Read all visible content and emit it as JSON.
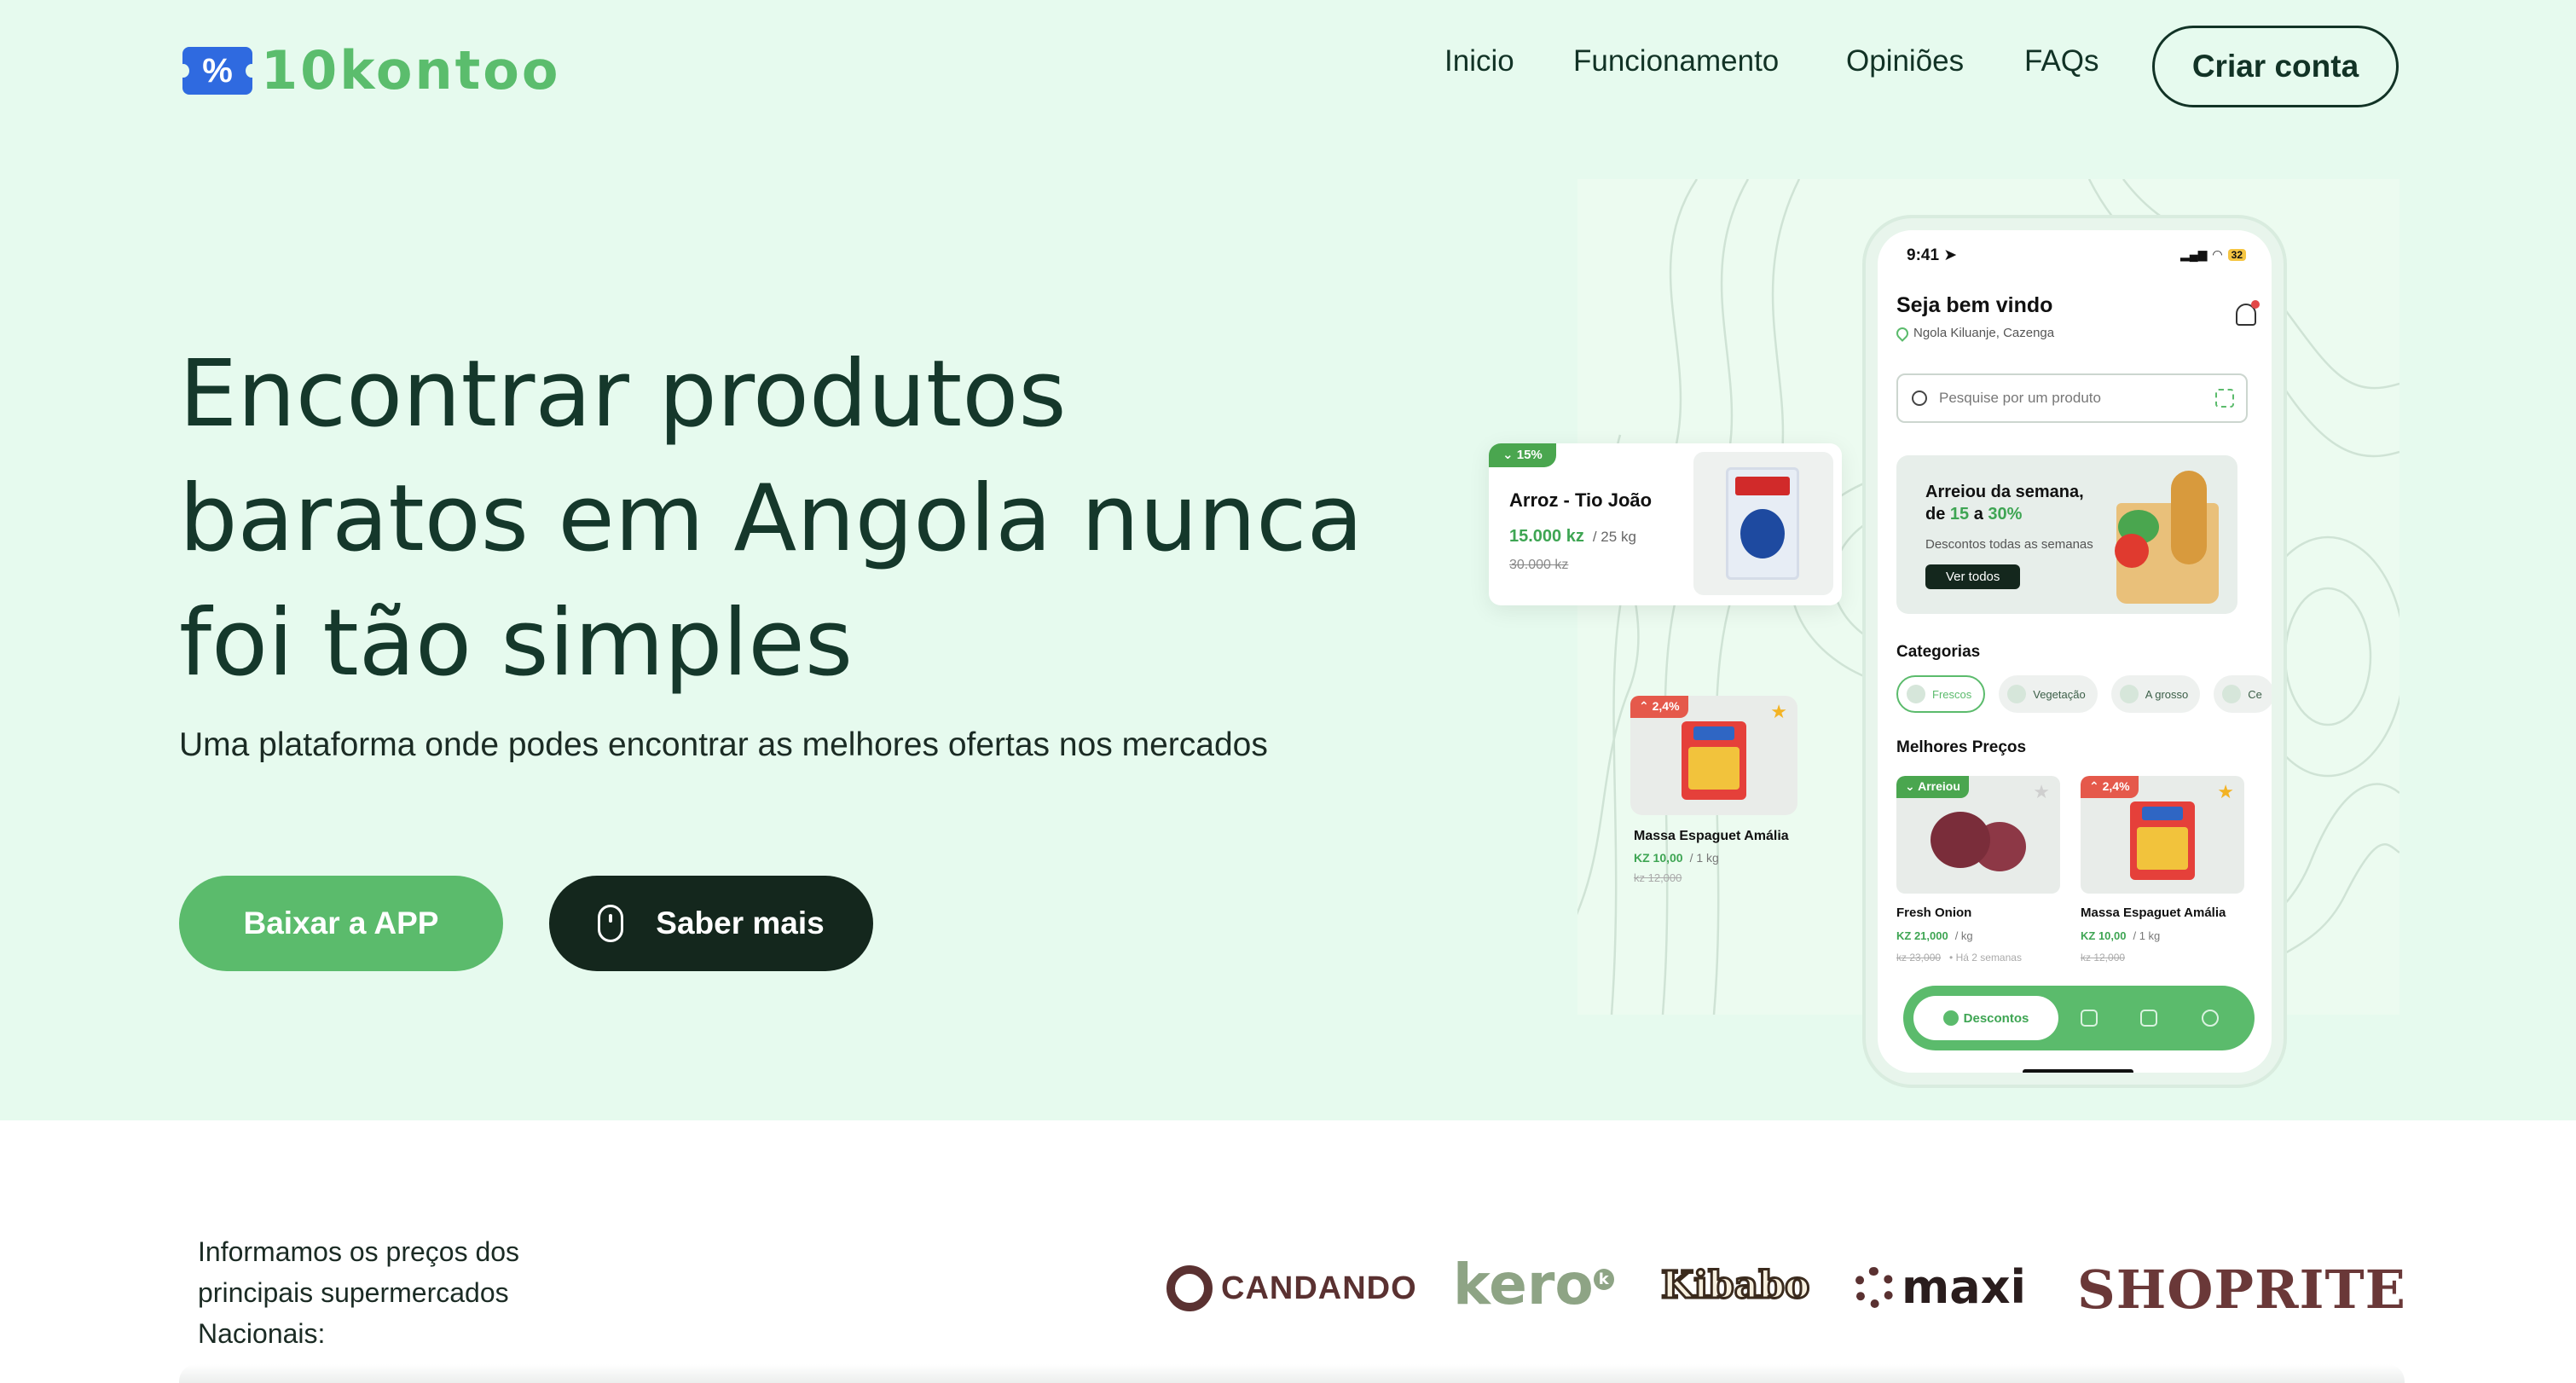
{
  "header": {
    "logo_text": "10kontoo",
    "logo_badge": "%",
    "nav": [
      "Inicio",
      "Funcionamento",
      "Opiniões",
      "FAQs"
    ],
    "cta": "Criar conta"
  },
  "hero": {
    "headline": "Encontrar produtos baratos em Angola nunca foi tão simples",
    "subline": "Uma plataforma onde podes encontrar as melhores ofertas nos mercados",
    "btn_download": "Baixar a APP",
    "btn_more": "Saber mais"
  },
  "floating_card_1": {
    "badge": "⌄ 15%",
    "name": "Arroz - Tio João",
    "price": "15.000 kz",
    "unit": "/ 25 kg",
    "old_price": "30.000 kz"
  },
  "floating_card_2": {
    "badge": "⌃ 2,4%",
    "name": "Massa Espaguet Amália",
    "price": "KZ 10,00",
    "unit": "/ 1 kg",
    "old_price": "kz 12,000"
  },
  "phone": {
    "time": "9:41",
    "battery": "32",
    "welcome": "Seja bem vindo",
    "location": "Ngola Kiluanje, Cazenga",
    "search_placeholder": "Pesquise por um produto",
    "banner_line1": "Arreiou da semana,",
    "banner_de": "de",
    "banner_from": "15",
    "banner_a": "a",
    "banner_to": "30%",
    "banner_sub": "Descontos todas as semanas",
    "banner_btn": "Ver todos",
    "categories_title": "Categorias",
    "categories": [
      "Frescos",
      "Vegetação",
      "A grosso",
      "Ce"
    ],
    "best_title": "Melhores Preços",
    "products": [
      {
        "badge": "⌄ Arreiou",
        "name": "Fresh Onion",
        "price": "KZ 21,000",
        "unit": "/ kg",
        "old_price": "kz 23,000",
        "note": "•  Há 2 semanas"
      },
      {
        "badge": "⌃ 2,4%",
        "name": "Massa Espaguet Amália",
        "price": "KZ 10,00",
        "unit": "/ 1 kg",
        "old_price": "kz 12,000",
        "note": ""
      }
    ],
    "nav_active": "Descontos"
  },
  "partners": {
    "text": "Informamos os preços dos principais supermercados Nacionais:",
    "logos": [
      "CANDANDO",
      "kero",
      "Kibabo",
      "maxi",
      "SHOPRITE"
    ]
  },
  "colors": {
    "hero_bg": "#e6faee",
    "brand_green": "#5bbb6c",
    "dark": "#14271d",
    "logo_blue": "#2f6ae0"
  }
}
